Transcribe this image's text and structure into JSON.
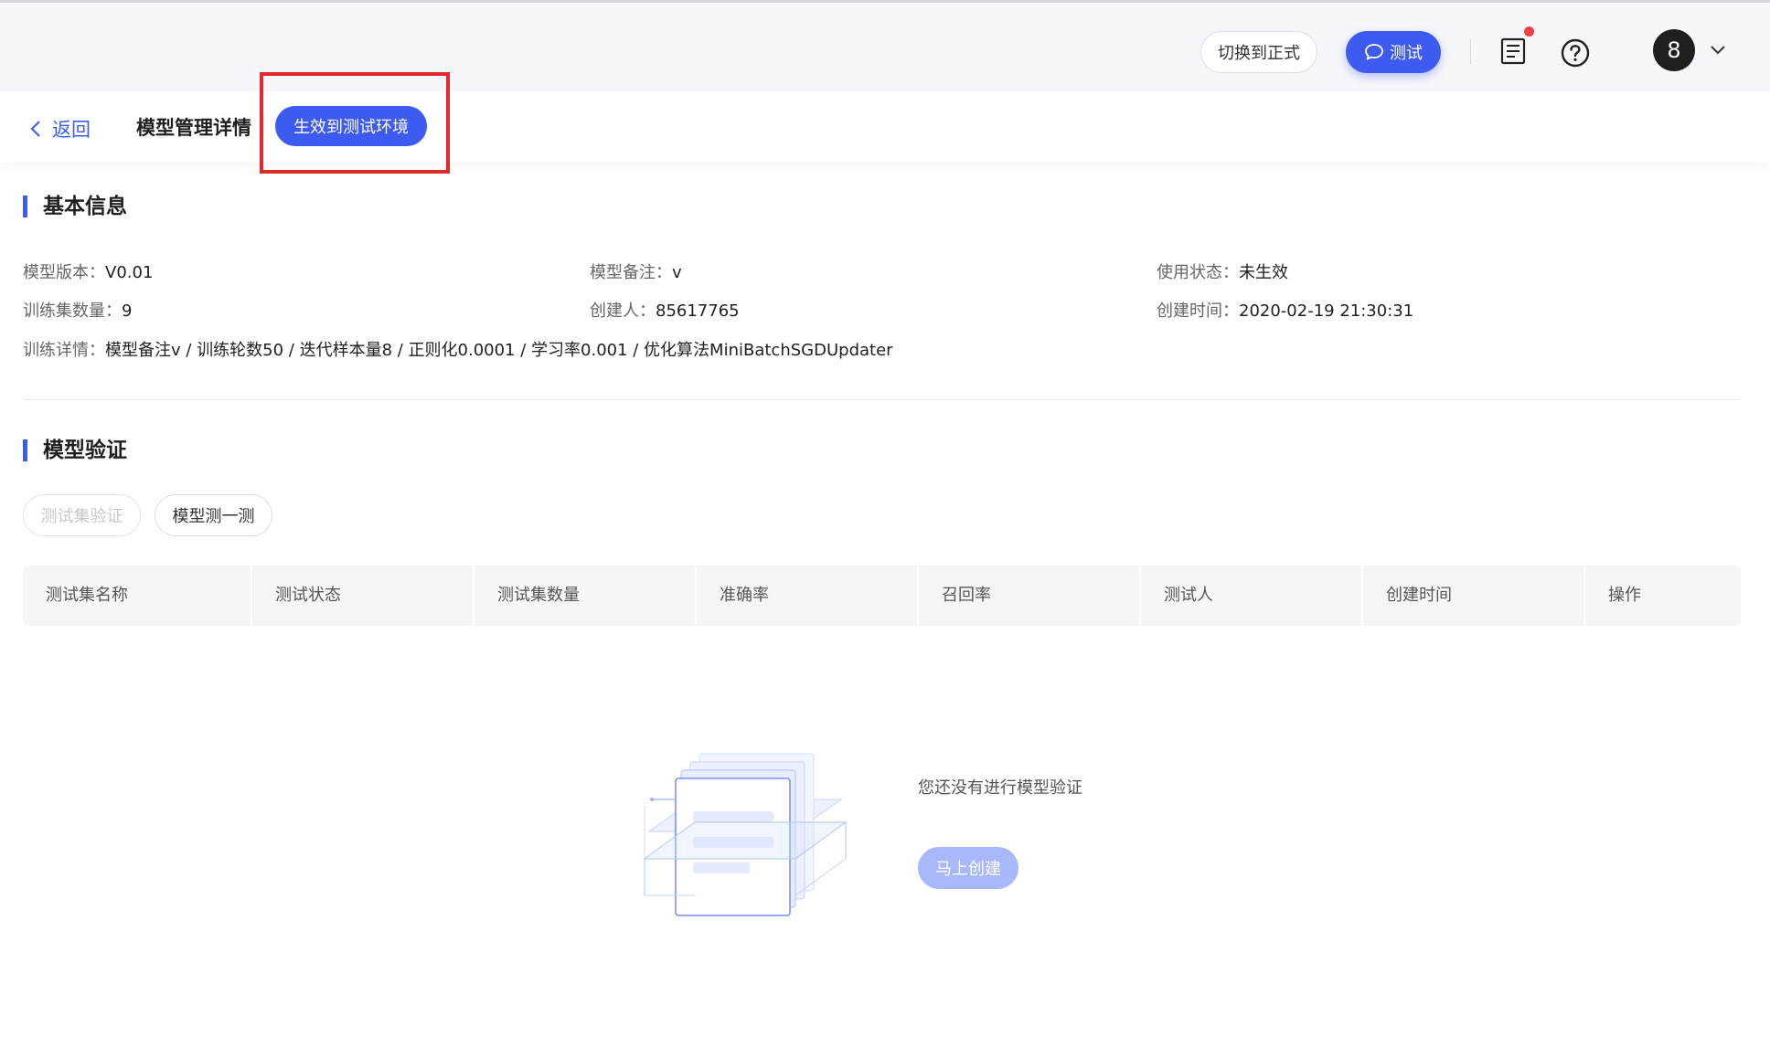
{
  "header": {
    "switch_label": "切换到正式",
    "test_label": "测试",
    "avatar_text": "8"
  },
  "subheader": {
    "back_label": "返回",
    "title": "模型管理详情",
    "deploy_label": "生效到测试环境"
  },
  "basic_info": {
    "title": "基本信息",
    "items": [
      {
        "label": "模型版本：",
        "value": "V0.01"
      },
      {
        "label": "模型备注：",
        "value": "v"
      },
      {
        "label": "使用状态：",
        "value": "未生效"
      },
      {
        "label": "训练集数量：",
        "value": "9"
      },
      {
        "label": "创建人：",
        "value": "85617765"
      },
      {
        "label": "创建时间：",
        "value": "2020-02-19 21:30:31"
      },
      {
        "label": "训练详情：",
        "value": "模型备注v / 训练轮数50 / 迭代样本量8 / 正则化0.0001 / 学习率0.001 / 优化算法MiniBatchSGDUpdater"
      }
    ]
  },
  "validation": {
    "title": "模型验证",
    "buttons": [
      "测试集验证",
      "模型测一测"
    ],
    "columns": [
      "测试集名称",
      "测试状态",
      "测试集数量",
      "准确率",
      "召回率",
      "测试人",
      "创建时间",
      "操作"
    ],
    "empty_text": "您还没有进行模型验证",
    "create_label": "马上创建"
  },
  "colors": {
    "accent": "#3d5af1",
    "highlight": "#e0282d",
    "notification": "#f04040"
  }
}
